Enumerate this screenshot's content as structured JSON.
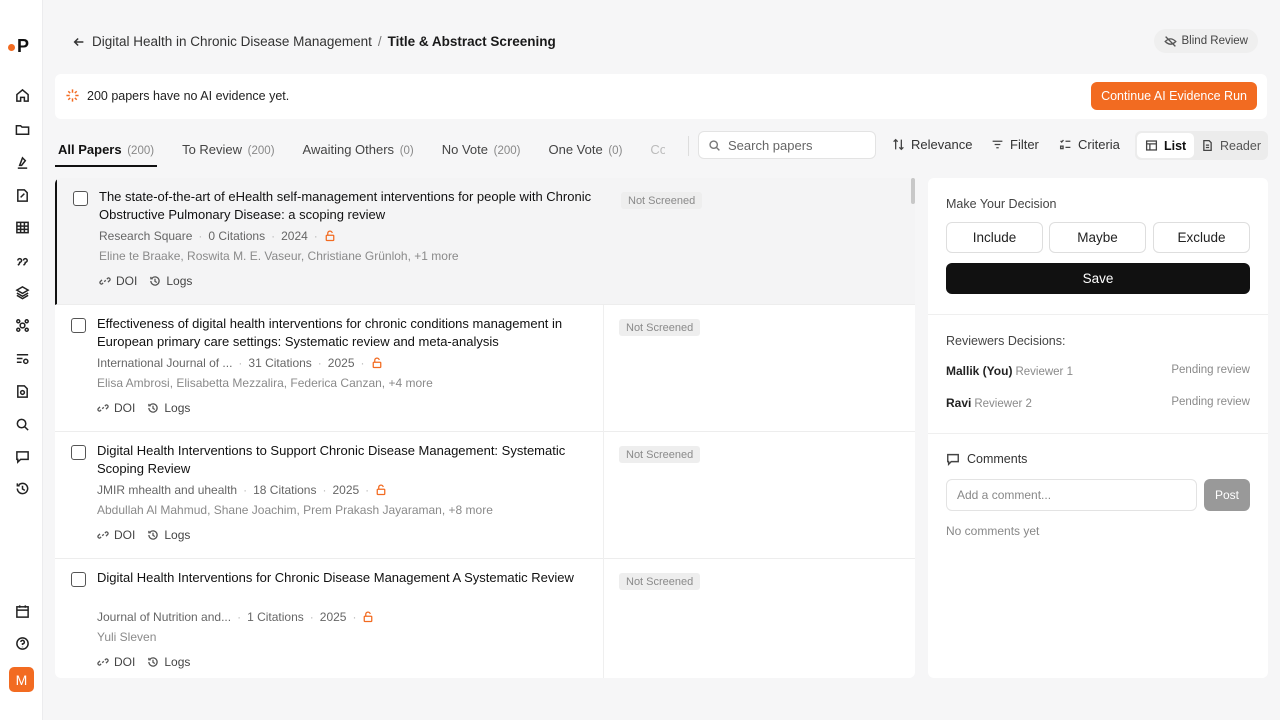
{
  "app": {
    "logo_letter": "P",
    "user_initial": "M"
  },
  "breadcrumb": {
    "project": "Digital Health in Chronic Disease Management",
    "separator": "/",
    "current": "Title & Abstract Screening"
  },
  "blind_review": {
    "label": "Blind Review"
  },
  "banner": {
    "message": "200 papers have no AI evidence yet.",
    "action_label": "Continue AI Evidence Run"
  },
  "tabs": [
    {
      "label": "All Papers",
      "count": "(200)"
    },
    {
      "label": "To Review",
      "count": "(200)"
    },
    {
      "label": "Awaiting Others",
      "count": "(0)"
    },
    {
      "label": "No Vote",
      "count": "(200)"
    },
    {
      "label": "One Vote",
      "count": "(0)"
    },
    {
      "label": "Co"
    }
  ],
  "search": {
    "placeholder": "Search papers"
  },
  "toolbar": {
    "sort_label": "Relevance",
    "filter_label": "Filter",
    "criteria_label": "Criteria",
    "list_label": "List",
    "reader_label": "Reader"
  },
  "papers": [
    {
      "title": "The state-of-the-art of eHealth self-management interventions for people with Chronic Obstructive Pulmonary Disease: a scoping review",
      "journal": "Research Square",
      "citations": "0 Citations",
      "year": "2024",
      "authors": "Eline te Braake, Roswita M. E. Vaseur, Christiane Grünloh, +1 more",
      "doi_label": "DOI",
      "logs_label": "Logs",
      "status": "Not Screened"
    },
    {
      "title": "Effectiveness of digital health interventions for chronic conditions management in European primary care settings: Systematic review and meta-analysis",
      "journal": "International Journal of ...",
      "citations": "31 Citations",
      "year": "2025",
      "authors": "Elisa Ambrosi, Elisabetta Mezzalira, Federica Canzan, +4 more",
      "doi_label": "DOI",
      "logs_label": "Logs",
      "status": "Not Screened"
    },
    {
      "title": "Digital Health Interventions to Support Chronic Disease Management: Systematic Scoping Review",
      "journal": "JMIR mhealth and uhealth",
      "citations": "18 Citations",
      "year": "2025",
      "authors": "Abdullah Al Mahmud, Shane Joachim, Prem Prakash Jayaraman, +8 more",
      "doi_label": "DOI",
      "logs_label": "Logs",
      "status": "Not Screened"
    },
    {
      "title": "Digital Health Interventions for Chronic Disease Management A Systematic Review",
      "journal": "Journal of Nutrition and...",
      "citations": "1 Citations",
      "year": "2025",
      "authors": "Yuli Sleven",
      "doi_label": "DOI",
      "logs_label": "Logs",
      "status": "Not Screened"
    }
  ],
  "decision": {
    "heading": "Make Your Decision",
    "include": "Include",
    "maybe": "Maybe",
    "exclude": "Exclude",
    "save": "Save"
  },
  "reviewers": {
    "heading": "Reviewers Decisions:",
    "items": [
      {
        "name": "Mallik (You)",
        "role": "Reviewer 1",
        "status": "Pending review"
      },
      {
        "name": "Ravi",
        "role": "Reviewer 2",
        "status": "Pending review"
      }
    ]
  },
  "comments": {
    "heading": "Comments",
    "placeholder": "Add a comment...",
    "post_label": "Post",
    "empty": "No comments yet"
  },
  "colors": {
    "accent": "#f26b21",
    "primary_dark": "#111111"
  }
}
